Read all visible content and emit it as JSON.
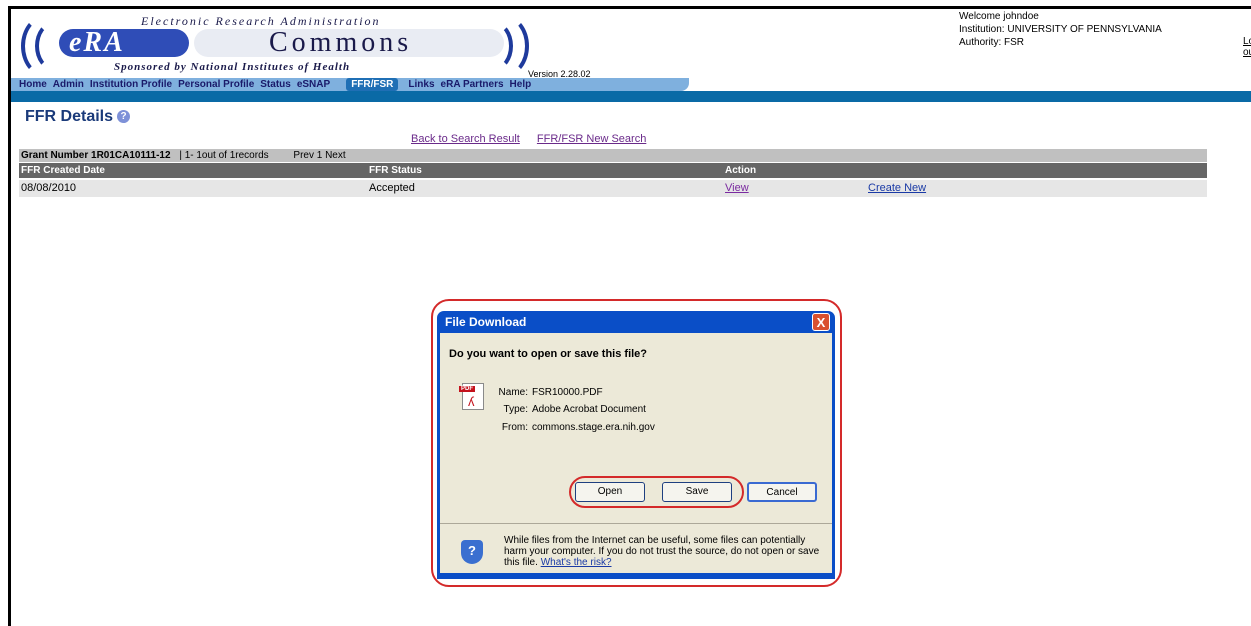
{
  "header": {
    "logo_top": "Electronic Research Administration",
    "logo_era": "eRA",
    "logo_commons": "Commons",
    "logo_sub": "Sponsored by National Institutes of Health",
    "version": "Version 2.28.02",
    "welcome": "Welcome johndoe",
    "institution": "Institution: UNIVERSITY OF PENNSYLVANIA",
    "authority": "Authority:  FSR",
    "logout": "Log-ou"
  },
  "nav": {
    "items": [
      "Home",
      "Admin",
      "Institution Profile",
      "Personal Profile",
      "Status",
      "eSNAP",
      "FFR/FSR",
      "Links",
      "eRA Partners",
      "Help"
    ],
    "active": "FFR/FSR"
  },
  "page": {
    "title": "FFR Details",
    "back_link": "Back to Search Result",
    "new_search_link": "FFR/FSR New Search",
    "grant_label": "Grant Number 1R01CA10111-12",
    "records": "|  1- 1out of 1records",
    "paging": "Prev 1 Next"
  },
  "table": {
    "headers": [
      "FFR Created Date",
      "FFR Status",
      "Action"
    ],
    "rows": [
      {
        "date": "08/08/2010",
        "status": "Accepted",
        "view": "View",
        "create": "Create New"
      }
    ]
  },
  "dialog": {
    "title": "File Download",
    "close": "X",
    "question": "Do you want to open or save this file?",
    "pdf_tag": "PDF",
    "name_label": "Name:",
    "name_value": "FSR10000.PDF",
    "type_label": "Type:",
    "type_value": "Adobe Acrobat Document",
    "from_label": "From:",
    "from_value": "commons.stage.era.nih.gov",
    "open": "Open",
    "save": "Save",
    "cancel": "Cancel",
    "warning_text": "While files from the Internet can be useful, some files can potentially harm your computer. If you do not trust the source, do not open or save this file.",
    "risk_link": "What's the risk?"
  },
  "colors": {
    "nav_bg": "#7fb0de",
    "blue_bar": "#0a6aa6",
    "dialog_title": "#0a4ec7",
    "highlight": "#d42a2a"
  }
}
